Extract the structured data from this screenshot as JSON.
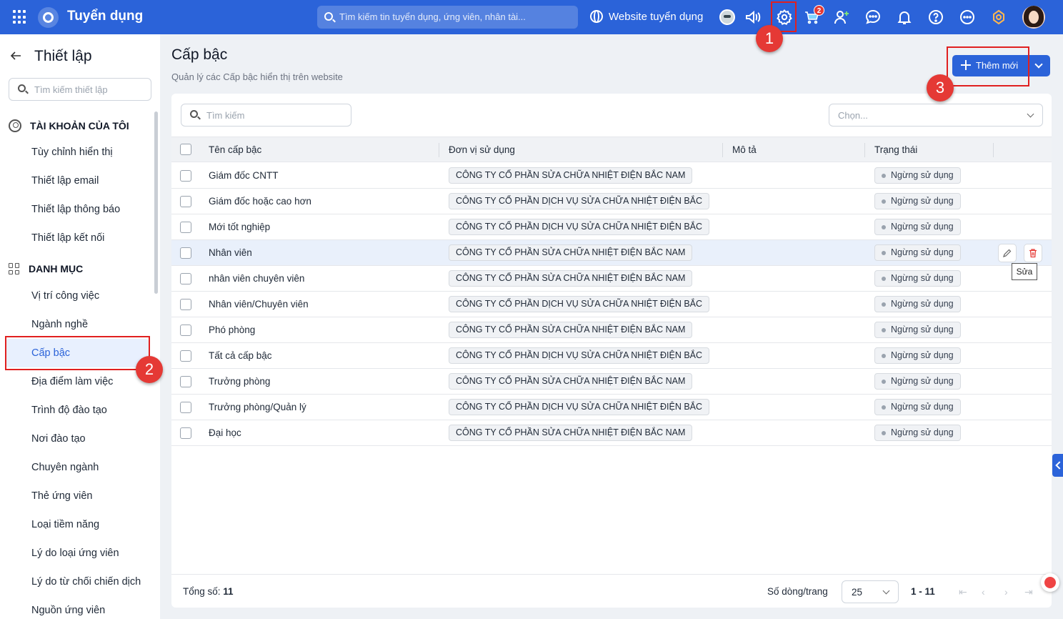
{
  "topbar": {
    "app_title": "Tuyển dụng",
    "search_placeholder": "Tìm kiếm tin tuyển dụng, ứng viên, nhân tài...",
    "website_link": "Website tuyển dụng",
    "cart_badge": "2"
  },
  "annotations": [
    "1",
    "2",
    "3"
  ],
  "sidebar": {
    "title": "Thiết lập",
    "search_placeholder": "Tìm kiếm thiết lập",
    "account_section": "TÀI KHOẢN CỦA TÔI",
    "account_items": [
      "Tùy chỉnh hiển thị",
      "Thiết lập email",
      "Thiết lập thông báo",
      "Thiết lập kết nối"
    ],
    "catalog_section": "DANH MỤC",
    "catalog_items": [
      "Vị trí công việc",
      "Ngành nghề",
      "Cấp bậc",
      "Địa điểm làm việc",
      "Trình độ đào tạo",
      "Nơi đào tạo",
      "Chuyên ngành",
      "Thẻ ứng viên",
      "Loại tiềm năng",
      "Lý do loại ứng viên",
      "Lý do từ chối chiến dịch",
      "Nguồn ứng viên"
    ],
    "active_item": "Cấp bậc"
  },
  "page": {
    "title": "Cấp bậc",
    "subtitle": "Quản lý các Cấp bậc hiển thị trên website",
    "add_button": "Thêm mới",
    "search_placeholder": "Tìm kiếm",
    "filter_placeholder": "Chọn..."
  },
  "table": {
    "columns": [
      "Tên cấp bậc",
      "Đơn vị sử dụng",
      "Mô tả",
      "Trạng thái"
    ],
    "rows": [
      {
        "name": "Giám đốc CNTT",
        "unit": "CÔNG TY CỔ PHẦN SỬA CHỮA NHIỆT ĐIỆN BẮC NAM",
        "desc": "",
        "status": "Ngừng sử dụng"
      },
      {
        "name": "Giám đốc hoặc cao hơn",
        "unit": "CÔNG TY CỔ PHẦN DỊCH VỤ SỬA CHỮA NHIỆT ĐIỆN BẮC",
        "desc": "",
        "status": "Ngừng sử dụng"
      },
      {
        "name": "Mới tốt nghiệp",
        "unit": "CÔNG TY CỔ PHẦN DỊCH VỤ SỬA CHỮA NHIỆT ĐIỆN BẮC",
        "desc": "",
        "status": "Ngừng sử dụng"
      },
      {
        "name": "Nhân viên",
        "unit": "CÔNG TY CỔ PHẦN SỬA CHỮA NHIỆT ĐIỆN BẮC NAM",
        "desc": "",
        "status": "Ngừng sử dụng"
      },
      {
        "name": "nhân viên chuyên viên",
        "unit": "CÔNG TY CỔ PHẦN SỬA CHỮA NHIỆT ĐIỆN BẮC NAM",
        "desc": "",
        "status": "Ngừng sử dụng"
      },
      {
        "name": "Nhân viên/Chuyên viên",
        "unit": "CÔNG TY CỔ PHẦN DỊCH VỤ SỬA CHỮA NHIỆT ĐIỆN BẮC",
        "desc": "",
        "status": "Ngừng sử dụng"
      },
      {
        "name": "Phó phòng",
        "unit": "CÔNG TY CỔ PHẦN SỬA CHỮA NHIỆT ĐIỆN BẮC NAM",
        "desc": "",
        "status": "Ngừng sử dụng"
      },
      {
        "name": "Tất cả cấp bậc",
        "unit": "CÔNG TY CỔ PHẦN DỊCH VỤ SỬA CHỮA NHIỆT ĐIỆN BẮC",
        "desc": "",
        "status": "Ngừng sử dụng"
      },
      {
        "name": "Trưởng phòng",
        "unit": "CÔNG TY CỔ PHẦN SỬA CHỮA NHIỆT ĐIỆN BẮC NAM",
        "desc": "",
        "status": "Ngừng sử dụng"
      },
      {
        "name": "Trưởng phòng/Quản lý",
        "unit": "CÔNG TY CỔ PHẦN DỊCH VỤ SỬA CHỮA NHIỆT ĐIỆN BẮC",
        "desc": "",
        "status": "Ngừng sử dụng"
      },
      {
        "name": "Đại học",
        "unit": "CÔNG TY CỔ PHẦN SỬA CHỮA NHIỆT ĐIỆN BẮC NAM",
        "desc": "",
        "status": "Ngừng sử dụng"
      }
    ],
    "hover_row": 3,
    "edit_tooltip": "Sửa"
  },
  "footer": {
    "total_label": "Tổng số:",
    "total_value": "11",
    "rows_per_page_label": "Số dòng/trang",
    "rows_per_page_value": "25",
    "range": "1 - 11"
  },
  "colors": {
    "primary": "#2b63d9",
    "annotation": "#e53935",
    "danger": "#e53935"
  }
}
